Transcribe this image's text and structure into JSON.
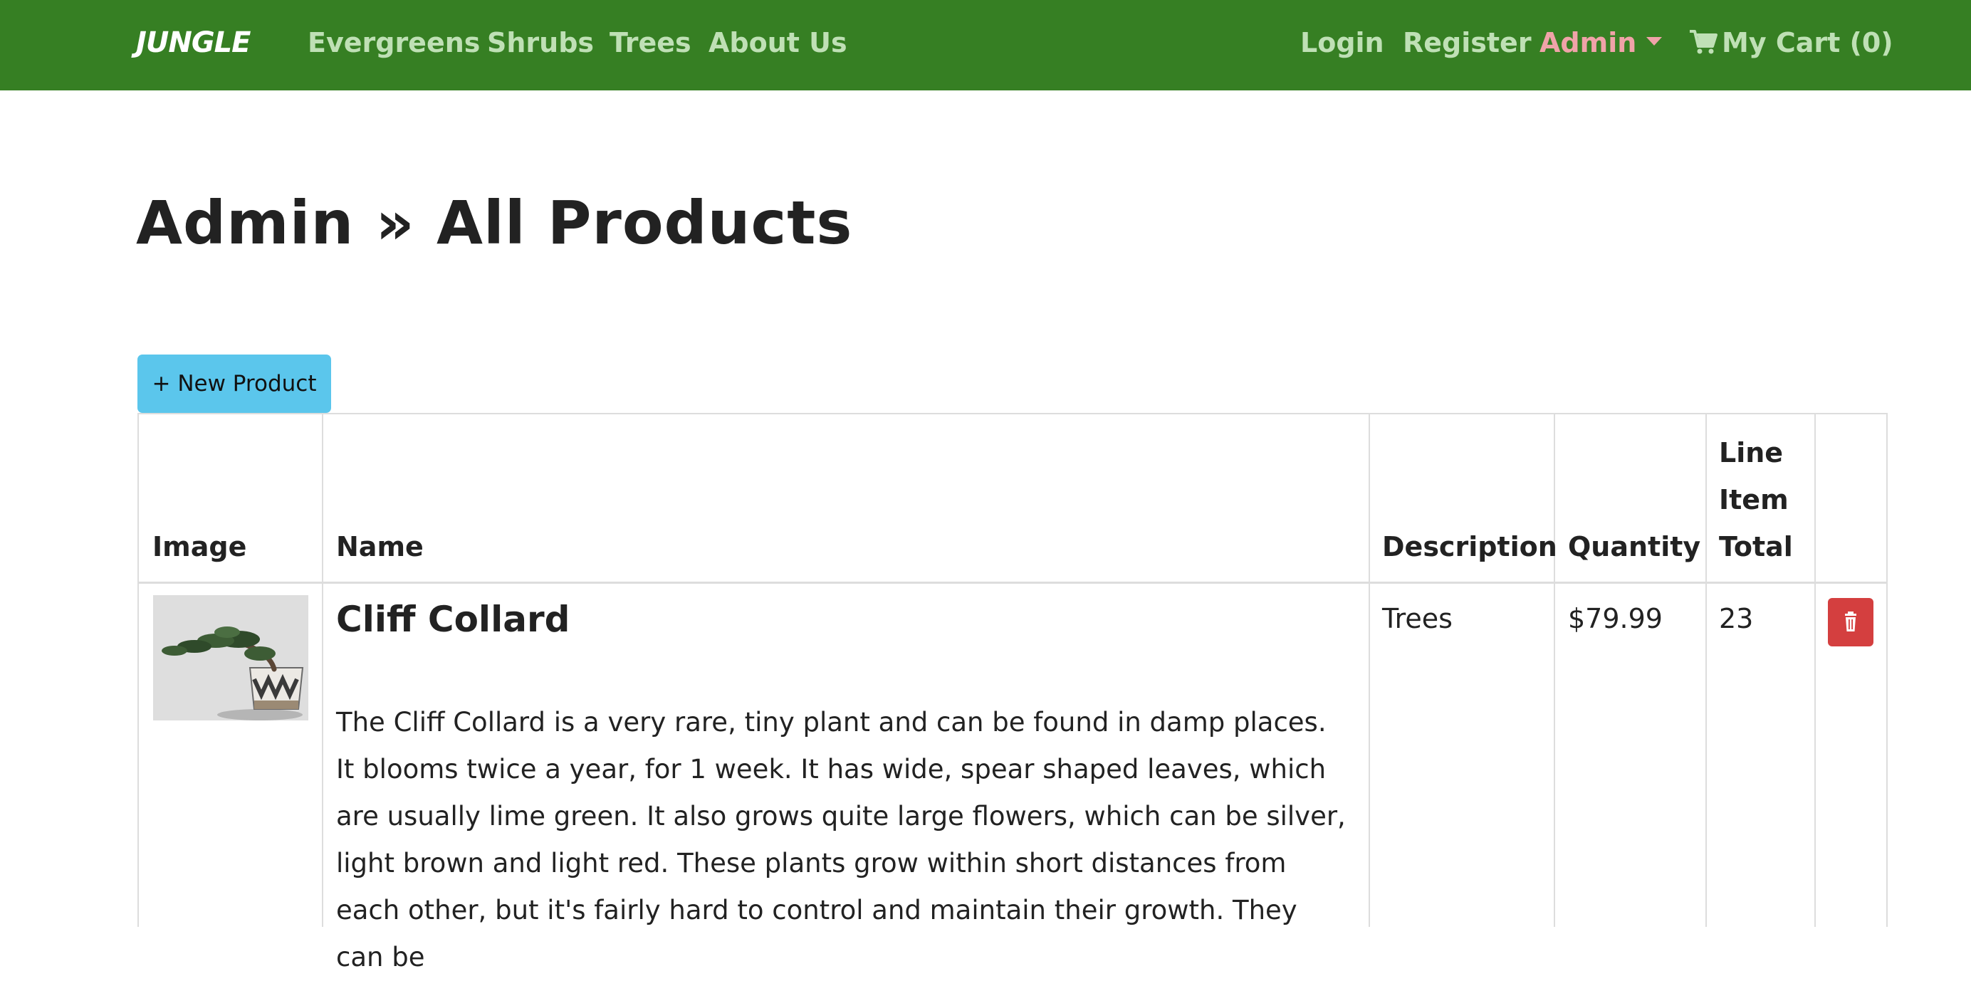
{
  "navbar": {
    "brand": "JUNGLE",
    "links": [
      "Evergreens",
      "Shrubs",
      "Trees",
      "About Us"
    ],
    "login": "Login",
    "register": "Register",
    "admin": "Admin",
    "cart": "My Cart (0)"
  },
  "page": {
    "title": "Admin » All Products"
  },
  "actions": {
    "new_product": "+ New Product"
  },
  "table": {
    "headers": {
      "image": "Image",
      "name": "Name",
      "description": "Description",
      "quantity": "Quantity",
      "line_item_total_1": "Line",
      "line_item_total_2": "Item",
      "line_item_total_3": "Total"
    },
    "rows": [
      {
        "name": "Cliff Collard",
        "description_text": "The Cliff Collard is a very rare, tiny plant and can be found in damp places. It blooms twice a year, for 1 week. It has wide, spear shaped leaves, which are usually lime green. It also grows quite large flowers, which can be silver, light brown and light red. These plants grow within short distances from each other, but it's fairly hard to control and maintain their growth. They can be",
        "category": "Trees",
        "price": "$79.99",
        "quantity": "23"
      }
    ]
  },
  "colors": {
    "navbar": "#367f23",
    "nav_link": "#bfe0b5",
    "admin_link": "#f0a3a8",
    "new_button": "#5bc6ec",
    "delete_button": "#d43f3f"
  },
  "icons": {
    "cart": "shopping-cart-icon",
    "delete": "trash-icon",
    "dropdown": "caret-down-icon"
  }
}
